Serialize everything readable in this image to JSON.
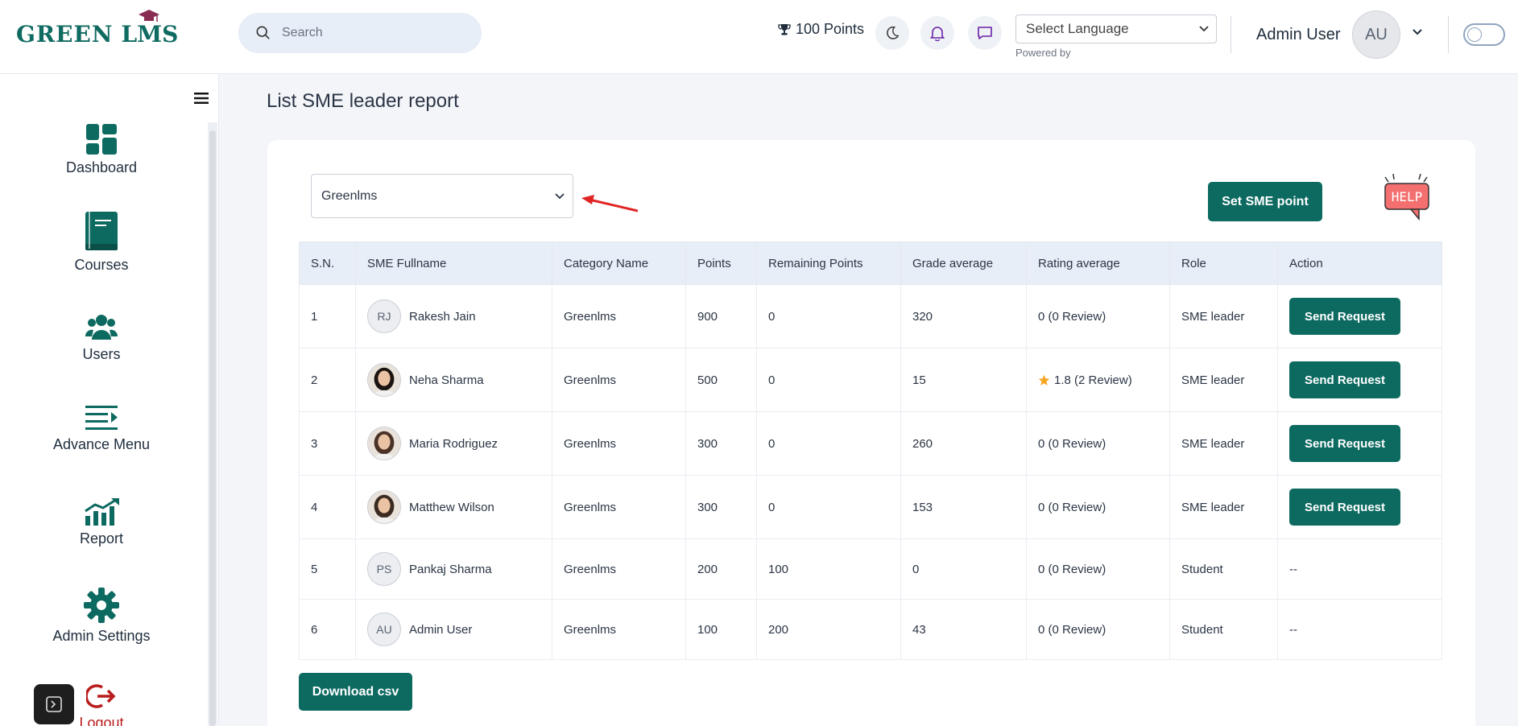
{
  "brand": {
    "logo_part1": "GREEN",
    "logo_part2": "LMS"
  },
  "header": {
    "search_placeholder": "Search",
    "points": "100 Points",
    "language_select": "Select Language",
    "powered_by": "Powered by",
    "user_name": "Admin User",
    "user_initials": "AU"
  },
  "sidebar": {
    "items": [
      {
        "label": "Dashboard",
        "icon": "dashboard-icon"
      },
      {
        "label": "Courses",
        "icon": "book-icon"
      },
      {
        "label": "Users",
        "icon": "users-icon"
      },
      {
        "label": "Advance Menu",
        "icon": "menu-list-icon"
      },
      {
        "label": "Report",
        "icon": "report-chart-icon"
      },
      {
        "label": "Admin Settings",
        "icon": "gear-icon"
      },
      {
        "label": "Logout",
        "icon": "logout-icon"
      }
    ]
  },
  "page": {
    "title": "List SME leader report",
    "category_selected": "Greenlms",
    "set_sme_button": "Set SME point",
    "help_label": "HELP",
    "download_button": "Download csv"
  },
  "table": {
    "headers": [
      "S.N.",
      "SME Fullname",
      "Category Name",
      "Points",
      "Remaining Points",
      "Grade average",
      "Rating average",
      "Role",
      "Action"
    ],
    "rows": [
      {
        "sn": "1",
        "initials": "RJ",
        "photo": false,
        "name": "Rakesh Jain",
        "category": "Greenlms",
        "points": "900",
        "remaining": "0",
        "grade": "320",
        "rating": "0 (0 Review)",
        "star": false,
        "role": "SME leader",
        "action": "Send Request"
      },
      {
        "sn": "2",
        "initials": "",
        "photo": true,
        "name": "Neha Sharma",
        "category": "Greenlms",
        "points": "500",
        "remaining": "0",
        "grade": "15",
        "rating": "1.8 (2 Review)",
        "star": true,
        "role": "SME leader",
        "action": "Send Request"
      },
      {
        "sn": "3",
        "initials": "",
        "photo": true,
        "name": "Maria Rodriguez",
        "category": "Greenlms",
        "points": "300",
        "remaining": "0",
        "grade": "260",
        "rating": "0 (0 Review)",
        "star": false,
        "role": "SME leader",
        "action": "Send Request"
      },
      {
        "sn": "4",
        "initials": "",
        "photo": true,
        "name": "Matthew Wilson",
        "category": "Greenlms",
        "points": "300",
        "remaining": "0",
        "grade": "153",
        "rating": "0 (0 Review)",
        "star": false,
        "role": "SME leader",
        "action": "Send Request"
      },
      {
        "sn": "5",
        "initials": "PS",
        "photo": false,
        "name": "Pankaj Sharma",
        "category": "Greenlms",
        "points": "200",
        "remaining": "100",
        "grade": "0",
        "rating": "0 (0 Review)",
        "star": false,
        "role": "Student",
        "action": "--"
      },
      {
        "sn": "6",
        "initials": "AU",
        "photo": false,
        "name": "Admin User",
        "category": "Greenlms",
        "points": "100",
        "remaining": "200",
        "grade": "43",
        "rating": "0 (0 Review)",
        "star": false,
        "role": "Student",
        "action": "--"
      }
    ]
  },
  "colors": {
    "brand": "#0d6a61",
    "accent_red": "#e02424",
    "star": "#f5a623"
  }
}
